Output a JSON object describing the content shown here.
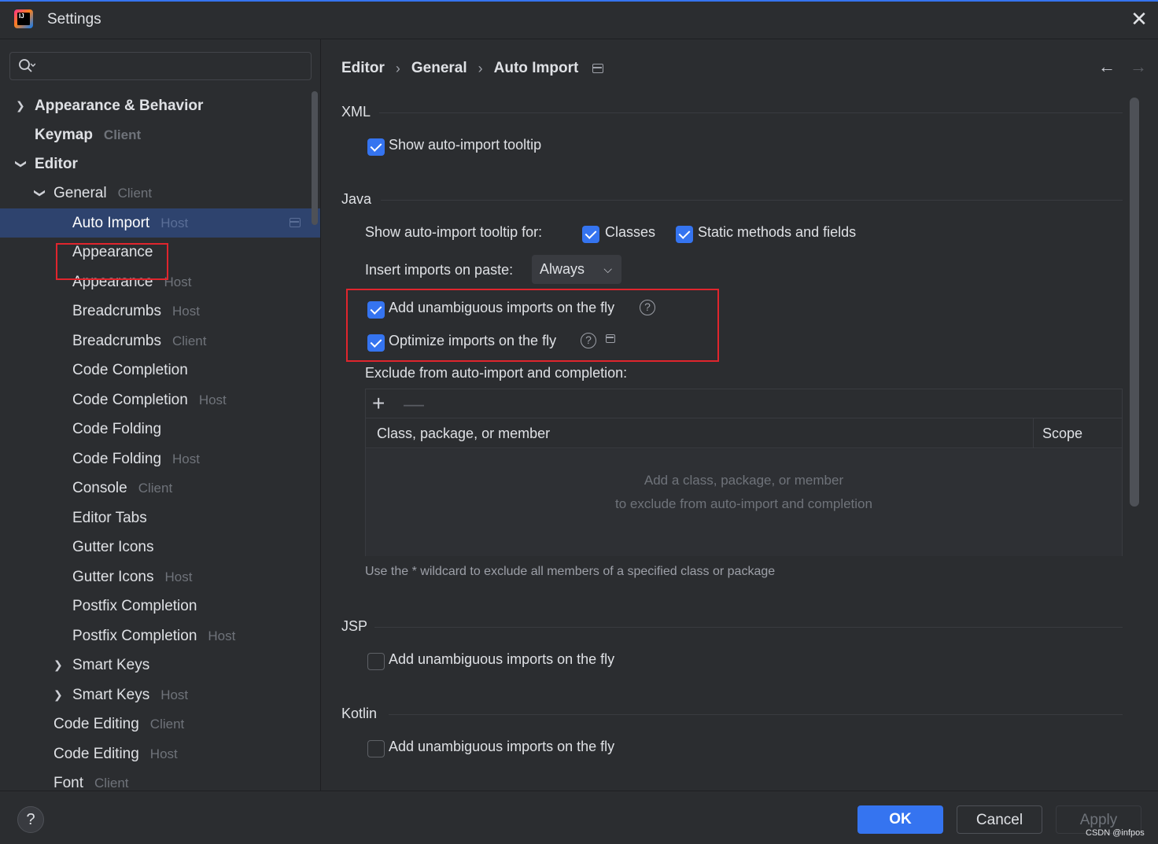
{
  "window": {
    "title": "Settings",
    "logo_text": "IJ"
  },
  "search": {
    "placeholder": "",
    "value": ""
  },
  "sidebar": {
    "items": [
      {
        "label": "Appearance & Behavior",
        "hint": "",
        "expanded": false
      },
      {
        "label": "Keymap",
        "hint": "Client"
      },
      {
        "label": "Editor",
        "hint": "",
        "expanded": true
      },
      {
        "label": "General",
        "hint": "Client",
        "expanded": true
      },
      {
        "label": "Auto Import",
        "hint": "Host",
        "selected": true
      },
      {
        "label": "Appearance",
        "hint": ""
      },
      {
        "label": "Appearance",
        "hint": "Host"
      },
      {
        "label": "Breadcrumbs",
        "hint": "Host"
      },
      {
        "label": "Breadcrumbs",
        "hint": "Client"
      },
      {
        "label": "Code Completion",
        "hint": ""
      },
      {
        "label": "Code Completion",
        "hint": "Host"
      },
      {
        "label": "Code Folding",
        "hint": ""
      },
      {
        "label": "Code Folding",
        "hint": "Host"
      },
      {
        "label": "Console",
        "hint": "Client"
      },
      {
        "label": "Editor Tabs",
        "hint": ""
      },
      {
        "label": "Gutter Icons",
        "hint": ""
      },
      {
        "label": "Gutter Icons",
        "hint": "Host"
      },
      {
        "label": "Postfix Completion",
        "hint": ""
      },
      {
        "label": "Postfix Completion",
        "hint": "Host"
      },
      {
        "label": "Smart Keys",
        "hint": "",
        "expanded": false
      },
      {
        "label": "Smart Keys",
        "hint": "Host",
        "expanded": false
      },
      {
        "label": "Code Editing",
        "hint": "Client"
      },
      {
        "label": "Code Editing",
        "hint": "Host"
      },
      {
        "label": "Font",
        "hint": "Client"
      }
    ]
  },
  "breadcrumb": {
    "items": [
      "Editor",
      "General",
      "Auto Import"
    ]
  },
  "sections": {
    "xml": {
      "title": "XML",
      "show_tooltip": {
        "label": "Show auto-import tooltip",
        "checked": true
      }
    },
    "java": {
      "title": "Java",
      "tooltip_for_label": "Show auto-import tooltip for:",
      "classes": {
        "label": "Classes",
        "checked": true
      },
      "static_methods": {
        "label": "Static methods and fields",
        "checked": true
      },
      "insert_on_paste_label": "Insert imports on paste:",
      "insert_on_paste_value": "Always",
      "add_unambiguous": {
        "label": "Add unambiguous imports on the fly",
        "checked": true
      },
      "optimize_imports": {
        "label": "Optimize imports on the fly",
        "checked": true
      },
      "exclude_label": "Exclude from auto-import and completion:",
      "table": {
        "columns": [
          "Class, package, or member",
          "Scope"
        ],
        "empty_line_1": "Add a class, package, or member",
        "empty_line_2": "to exclude from auto-import and completion"
      },
      "wildcard_hint": "Use the * wildcard to exclude all members of a specified class or package"
    },
    "jsp": {
      "title": "JSP",
      "add_unambiguous": {
        "label": "Add unambiguous imports on the fly",
        "checked": false
      }
    },
    "kotlin": {
      "title": "Kotlin",
      "add_unambiguous": {
        "label": "Add unambiguous imports on the fly",
        "checked": false
      }
    }
  },
  "footer": {
    "help_label": "?",
    "ok_label": "OK",
    "cancel_label": "Cancel",
    "apply_label": "Apply",
    "watermark": "CSDN @infpos"
  },
  "colors": {
    "accent": "#3574f0",
    "highlight_box": "#e0252d",
    "background": "#2b2d30"
  }
}
